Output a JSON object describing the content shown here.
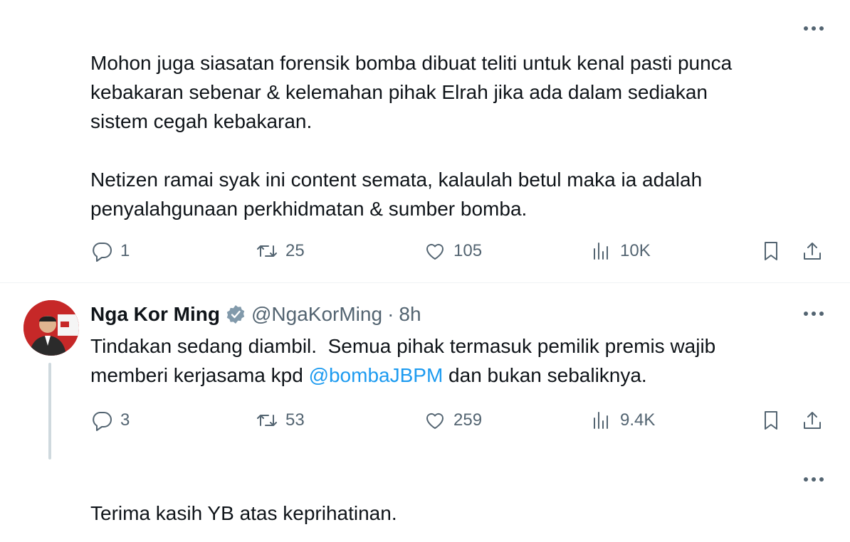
{
  "tweet1": {
    "text": "Mohon juga siasatan forensik bomba dibuat teliti untuk kenal pasti punca\nkebakaran sebenar & kelemahan pihak Elrah jika ada dalam sediakan\nsistem cegah kebakaran.\n\nNetizen ramai syak ini content semata, kalaulah betul maka ia adalah\npenyalahgunaan perkhidmatan & sumber bomba.",
    "replies": "1",
    "retweets": "25",
    "likes": "105",
    "views": "10K"
  },
  "tweet2": {
    "name": "Nga Kor Ming",
    "handle": "@NgaKorMing",
    "separator": "·",
    "time": "8h",
    "text_before": "Tindakan sedang diambil.  Semua pihak termasuk pemilik premis wajib\nmemberi kerjasama kpd ",
    "mention": "@bombaJBPM",
    "text_after": " dan bukan sebaliknya.",
    "replies": "3",
    "retweets": "53",
    "likes": "259",
    "views": "9.4K"
  },
  "tweet3": {
    "text": "Terima kasih YB atas keprihatinan."
  },
  "icons": {
    "more": "more-horizontal-icon",
    "reply": "reply-bubble-icon",
    "retweet": "retweet-icon",
    "like": "heart-icon",
    "views": "analytics-bars-icon",
    "bookmark": "bookmark-icon",
    "share": "share-upload-icon",
    "verified": "verified-badge-icon"
  },
  "colors": {
    "text": "#0f1419",
    "secondary": "#536471",
    "link": "#1d9bf0",
    "divider": "#eff3f4",
    "verified_badge": "#829aab"
  }
}
